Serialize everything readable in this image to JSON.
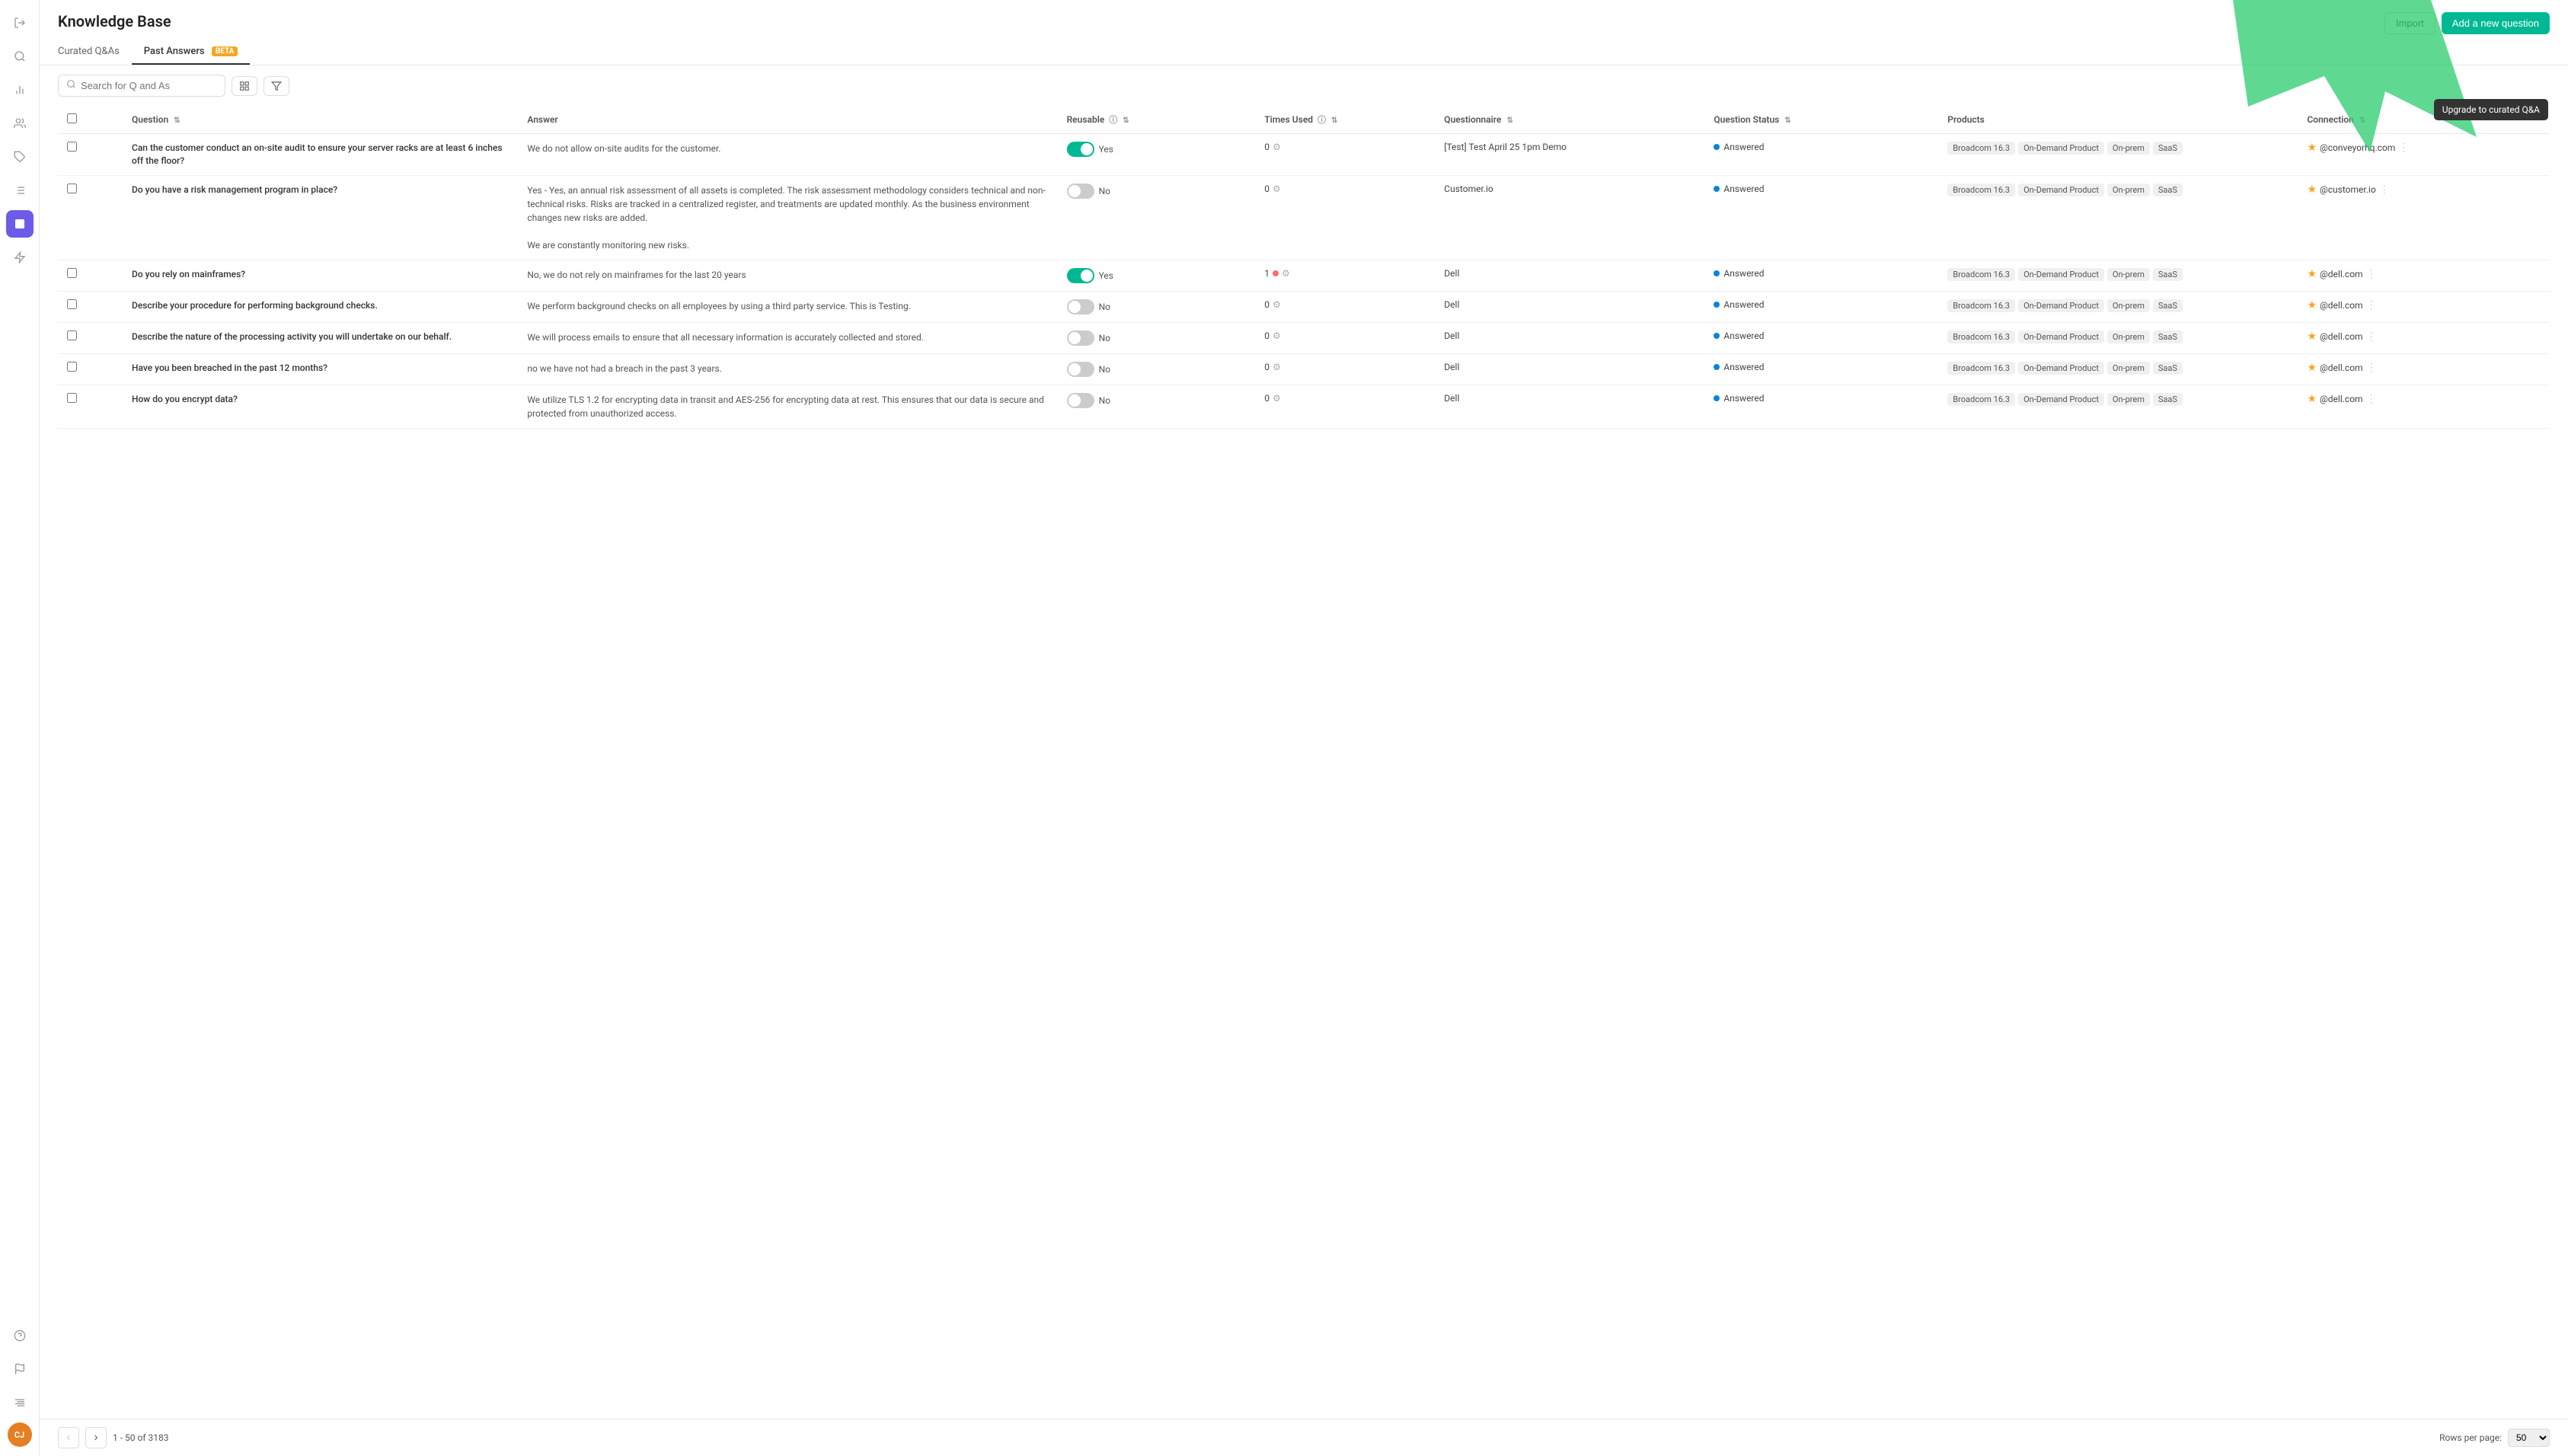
{
  "sidebar": {
    "icons": [
      {
        "name": "logout-icon",
        "symbol": "→",
        "active": false
      },
      {
        "name": "search-icon",
        "symbol": "🔍",
        "active": false
      },
      {
        "name": "chart-icon",
        "symbol": "📊",
        "active": false
      },
      {
        "name": "users-icon",
        "symbol": "👥",
        "active": false
      },
      {
        "name": "tag-icon",
        "symbol": "🏷",
        "active": false
      },
      {
        "name": "list-icon",
        "symbol": "☰",
        "active": false
      },
      {
        "name": "knowledge-icon",
        "symbol": "■",
        "active": true
      },
      {
        "name": "integration-icon",
        "symbol": "⚡",
        "active": false
      }
    ],
    "bottom_icons": [
      {
        "name": "help-icon",
        "symbol": "?"
      },
      {
        "name": "flag-icon",
        "symbol": "⚑"
      },
      {
        "name": "settings-icon",
        "symbol": "⇅"
      }
    ],
    "avatar": {
      "initials": "CJ",
      "bg": "#e67e22"
    }
  },
  "header": {
    "title": "Knowledge Base",
    "import_label": "Import",
    "add_label": "Add a new question",
    "tabs": [
      {
        "label": "Curated Q&As",
        "active": false
      },
      {
        "label": "Past Answers",
        "active": true,
        "badge": "BETA"
      }
    ]
  },
  "toolbar": {
    "search_placeholder": "Search for Q and As",
    "layout_icon": "⊞",
    "filter_icon": "▽"
  },
  "table": {
    "columns": [
      {
        "key": "check",
        "label": ""
      },
      {
        "key": "question",
        "label": "Question",
        "sortable": true
      },
      {
        "key": "answer",
        "label": "Answer"
      },
      {
        "key": "reusable",
        "label": "Reusable",
        "has_info": true,
        "sortable": true
      },
      {
        "key": "times_used",
        "label": "Times Used",
        "has_info": true,
        "sortable": true
      },
      {
        "key": "questionnaire",
        "label": "Questionnaire",
        "sortable": true
      },
      {
        "key": "question_status",
        "label": "Question Status",
        "sortable": true
      },
      {
        "key": "products",
        "label": "Products"
      },
      {
        "key": "connection",
        "label": "Connection",
        "sortable": true
      }
    ],
    "rows": [
      {
        "id": 1,
        "question": "Can the customer conduct an on-site audit to ensure your server racks are at least 6 inches off the floor?",
        "answer": "We do not allow on-site audits for the customer.",
        "reusable": true,
        "reusable_label": "Yes",
        "times_used": 0,
        "times_alert": false,
        "questionnaire": "[Test] Test April 25 1pm Demo",
        "status": "Answered",
        "status_color": "answered",
        "products": [
          "Broadcom 16.3",
          "On-Demand Product",
          "On-prem",
          "SaaS"
        ],
        "connection": "@conveyorhq.com",
        "starred": true
      },
      {
        "id": 2,
        "question": "Do you have a risk management program in place?",
        "answer": "Yes - Yes, an annual risk assessment of all assets is completed. The risk assessment methodology considers technical and non-technical risks. Risks are tracked in a centralized register, and treatments are updated monthly. As the business environment changes new risks are added.\n\nWe are constantly monitoring new risks.",
        "reusable": false,
        "reusable_label": "No",
        "times_used": 0,
        "times_alert": false,
        "questionnaire": "Customer.io",
        "status": "Answered",
        "status_color": "answered",
        "products": [
          "Broadcom 16.3",
          "On-Demand Product",
          "On-prem",
          "SaaS"
        ],
        "connection": "@customer.io",
        "starred": true
      },
      {
        "id": 3,
        "question": "Do you rely on mainframes?",
        "answer": "No, we do not rely on mainframes for the last 20 years",
        "reusable": true,
        "reusable_label": "Yes",
        "times_used": 1,
        "times_alert": true,
        "questionnaire": "Dell",
        "status": "Answered",
        "status_color": "answered",
        "products": [
          "Broadcom 16.3",
          "On-Demand Product",
          "On-prem",
          "SaaS"
        ],
        "connection": "@dell.com",
        "starred": true
      },
      {
        "id": 4,
        "question": "Describe your procedure for performing background checks.",
        "answer": "We perform background checks on all employees by using a third party service. This is Testing.",
        "reusable": false,
        "reusable_label": "No",
        "times_used": 0,
        "times_alert": false,
        "questionnaire": "Dell",
        "status": "Answered",
        "status_color": "answered",
        "products": [
          "Broadcom 16.3",
          "On-Demand Product",
          "On-prem",
          "SaaS"
        ],
        "connection": "@dell.com",
        "starred": true
      },
      {
        "id": 5,
        "question": "Describe the nature of the processing activity you will undertake on our behalf.",
        "answer": "We will process emails to ensure that all necessary information is accurately collected and stored.",
        "reusable": false,
        "reusable_label": "No",
        "times_used": 0,
        "times_alert": false,
        "questionnaire": "Dell",
        "status": "Answered",
        "status_color": "answered",
        "products": [
          "Broadcom 16.3",
          "On-Demand Product",
          "On-prem",
          "SaaS"
        ],
        "connection": "@dell.com",
        "starred": true
      },
      {
        "id": 6,
        "question": "Have you been breached in the past 12 months?",
        "answer": "no we have not had a breach in the past 3 years.",
        "reusable": false,
        "reusable_label": "No",
        "times_used": 0,
        "times_alert": false,
        "questionnaire": "Dell",
        "status": "Answered",
        "status_color": "answered",
        "products": [
          "Broadcom 16.3",
          "On-Demand Product",
          "On-prem",
          "SaaS"
        ],
        "connection": "@dell.com",
        "starred": true
      },
      {
        "id": 7,
        "question": "How do you encrypt data?",
        "answer": "We utilize TLS 1.2 for encrypting data in transit and AES-256 for encrypting data at rest. This ensures that our data is secure and protected from unauthorized access.",
        "reusable": false,
        "reusable_label": "No",
        "times_used": 0,
        "times_alert": false,
        "questionnaire": "Dell",
        "status": "Answered",
        "status_color": "answered",
        "products": [
          "Broadcom 16.3",
          "On-Demand Product",
          "On-prem",
          "SaaS"
        ],
        "connection": "@dell.com",
        "starred": true
      }
    ]
  },
  "footer": {
    "pagination_info": "1 - 50 of 3183",
    "rows_per_page_label": "Rows per page:",
    "rows_per_page_value": "50"
  },
  "tooltip": {
    "label": "Upgrade to curated Q&A"
  },
  "colors": {
    "accent_green": "#00b894",
    "accent_blue": "#0984e3",
    "accent_orange": "#f5a623",
    "tag_bg": "#f0f0f0",
    "active_sidebar": "#6c5ce7"
  }
}
